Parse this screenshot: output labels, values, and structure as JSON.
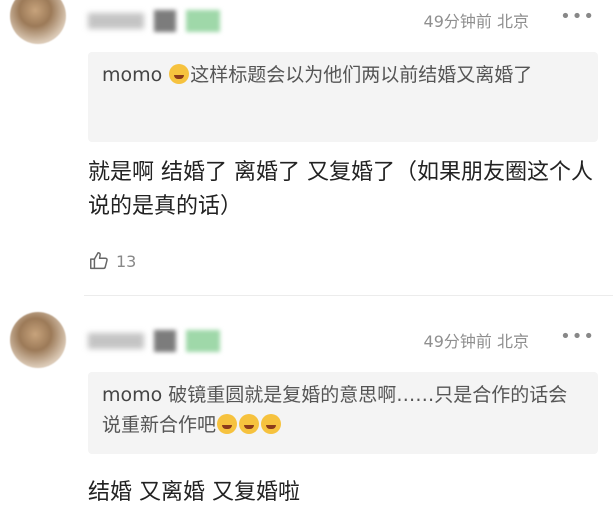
{
  "comments": [
    {
      "time": "49分钟前",
      "location": "北京",
      "more": "•••",
      "quote_name": "momo",
      "quote_text": "这样标题会以为他们两以前结婚又离婚了",
      "body": "就是啊 结婚了 离婚了 又复婚了（如果朋友圈这个人说的是真的话）",
      "likes": "13"
    },
    {
      "time": "49分钟前",
      "location": "北京",
      "more": "•••",
      "quote_name": "momo",
      "quote_text": "破镜重圆就是复婚的意思啊……只是合作的话会说重新合作吧",
      "body": "结婚 又离婚 又复婚啦"
    }
  ]
}
